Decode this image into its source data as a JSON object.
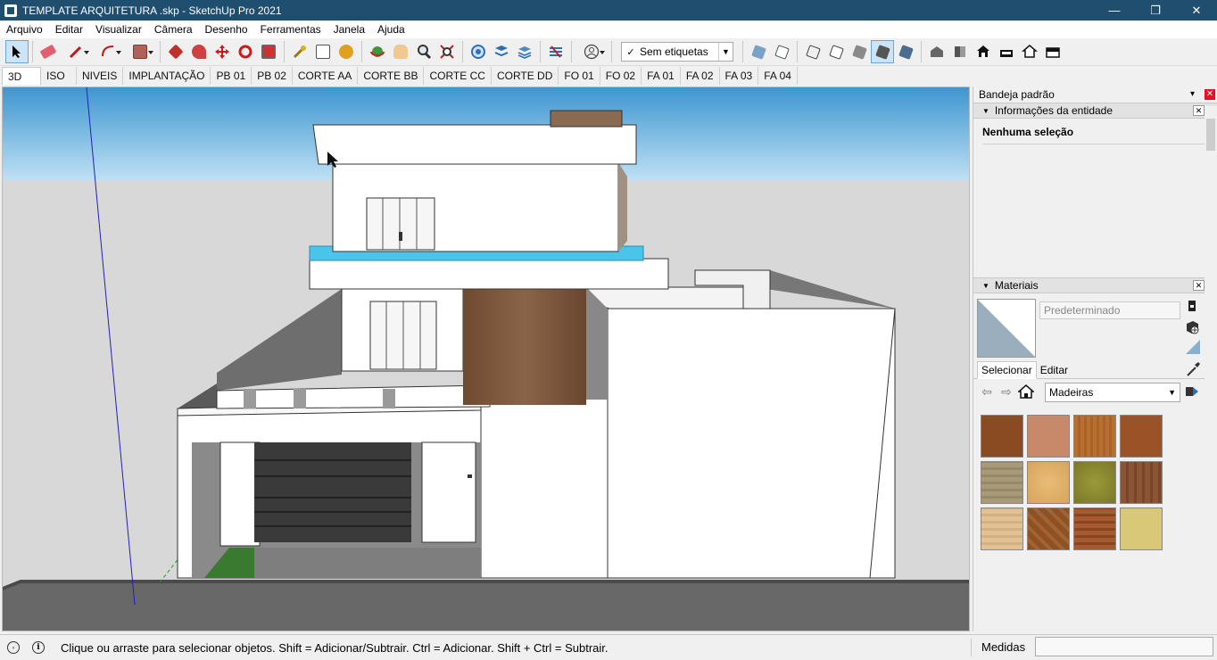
{
  "window": {
    "title": "TEMPLATE ARQUITETURA  .skp - SketchUp Pro 2021",
    "minimize": "—",
    "restore": "❐",
    "close": "✕"
  },
  "menu": [
    "Arquivo",
    "Editar",
    "Visualizar",
    "Câmera",
    "Desenho",
    "Ferramentas",
    "Janela",
    "Ajuda"
  ],
  "toolbar": {
    "tag_selector": "Sem etiquetas",
    "tag_check": "✓"
  },
  "scenes": [
    "3D",
    "ISO",
    "NIVEIS",
    "IMPLANTAÇÃO",
    "PB 01",
    "PB 02",
    "CORTE AA",
    "CORTE BB",
    "CORTE CC",
    "CORTE DD",
    "FO 01",
    "FO 02",
    "FA 01",
    "FA 02",
    "FA 03",
    "FA 04"
  ],
  "active_scene": "3D",
  "tray": {
    "title": "Bandeja padrão",
    "entity_panel": {
      "title": "Informações da entidade",
      "value": "Nenhuma seleção"
    },
    "materials_panel": {
      "title": "Materiais",
      "material_name": "Predeterminado",
      "tabs": [
        "Selecionar",
        "Editar"
      ],
      "library": "Madeiras",
      "swatches": [
        "#8a4a22",
        "#c8896a",
        "#b8702e",
        "#9a5226",
        "#a89a78",
        "#e0b06a",
        "#8c8a32",
        "#8a5436",
        "#e2c294",
        "#8c5224",
        "#a65a30",
        "#d8c878"
      ]
    }
  },
  "status": {
    "hint": "Clique ou arraste para selecionar objetos. Shift = Adicionar/Subtrair. Ctrl = Adicionar. Shift + Ctrl = Subtrair.",
    "measure_label": "Medidas",
    "measure_value": ""
  }
}
